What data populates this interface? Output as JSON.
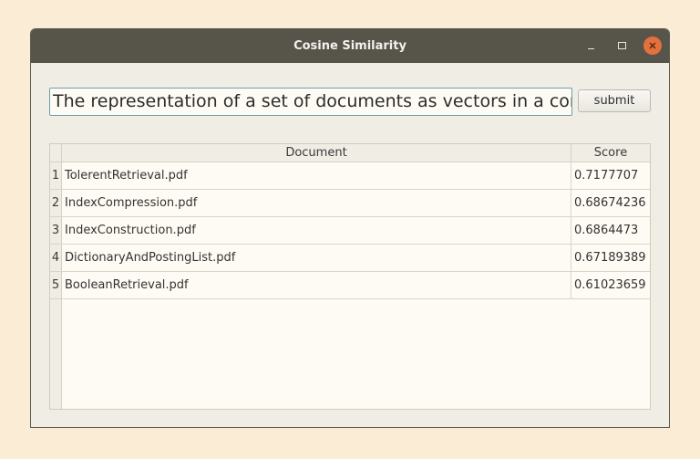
{
  "window": {
    "title": "Cosine Similarity"
  },
  "query": {
    "value": "The representation of a set of documents as vectors in a commo"
  },
  "submit": {
    "label": "submit"
  },
  "table": {
    "headers": [
      "Document",
      "Score"
    ],
    "rows": [
      {
        "num": "1",
        "document": "TolerentRetrieval.pdf",
        "score": "0.7177707"
      },
      {
        "num": "2",
        "document": "IndexCompression.pdf",
        "score": "0.68674236"
      },
      {
        "num": "3",
        "document": "IndexConstruction.pdf",
        "score": "0.6864473"
      },
      {
        "num": "4",
        "document": "DictionaryAndPostingList.pdf",
        "score": "0.67189389"
      },
      {
        "num": "5",
        "document": "BooleanRetrieval.pdf",
        "score": "0.61023659"
      }
    ]
  },
  "colors": {
    "titlebar": "#57544a",
    "close_button": "#e3703d",
    "input_focus_border": "#6f9eae",
    "window_bg": "#efede4",
    "desktop_bg": "#fbecd6"
  },
  "icons": {
    "minimize": "minimize-icon",
    "maximize": "maximize-icon",
    "close": "close-icon"
  }
}
